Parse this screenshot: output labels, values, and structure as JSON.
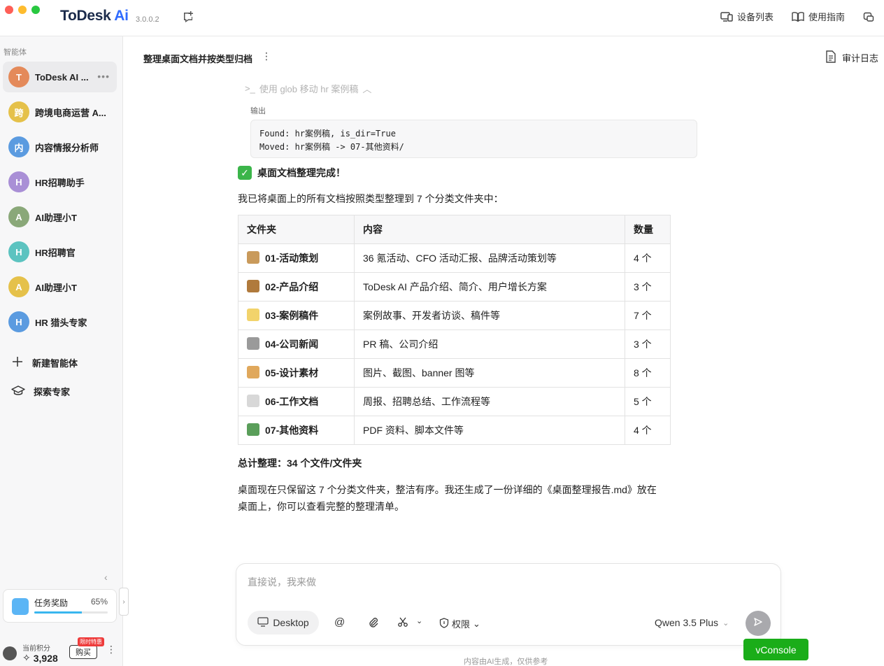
{
  "app": {
    "brand_main": "ToDesk ",
    "brand_ai": "Ai",
    "version": "3.0.0.2",
    "top_actions": {
      "devices": "设备列表",
      "guide": "使用指南"
    }
  },
  "sidebar": {
    "section_label": "智能体",
    "agents": [
      {
        "initial": "T",
        "name": "ToDesk AI ...",
        "color": "#e48a5a"
      },
      {
        "initial": "跨",
        "name": "跨境电商运营 A...",
        "color": "#e5c14a"
      },
      {
        "initial": "内",
        "name": "内容情报分析师",
        "color": "#5b9be0"
      },
      {
        "initial": "H",
        "name": "HR招聘助手",
        "color": "#a98fd6"
      },
      {
        "initial": "A",
        "name": "AI助理小T",
        "color": "#8aa879"
      },
      {
        "initial": "H",
        "name": "HR招聘官",
        "color": "#5cc3c0"
      },
      {
        "initial": "A",
        "name": "AI助理小T",
        "color": "#e5c14a"
      },
      {
        "initial": "H",
        "name": "HR 猎头专家",
        "color": "#5b9be0"
      }
    ],
    "new_agent": "新建智能体",
    "explore": "探索专家",
    "reward": {
      "title": "任务奖励",
      "percent": "65%",
      "progress": 0.65
    },
    "points_label": "当前积分",
    "points_value": "3,928",
    "promo_badge": "限时特惠",
    "buy_label": "购买"
  },
  "main": {
    "conversation_title": "整理桌面文档并按类型归档",
    "audit_log": "审计日志",
    "tool_call": "使用 glob 移动 hr 案例稿",
    "output_label": "输出",
    "code_lines": [
      "Found: hr案例稿, is_dir=True",
      "Moved: hr案例稿 -> 07-其他资料/"
    ],
    "done_title": "桌面文档整理完成！",
    "intro": "我已将桌面上的所有文档按照类型整理到 7 个分类文件夹中：",
    "table": {
      "headers": [
        "文件夹",
        "内容",
        "数量"
      ],
      "rows": [
        {
          "icon": "clipboard-icon",
          "icon_color": "#c99a5b",
          "folder": "01-活动策划",
          "content": "36 氪活动、CFO 活动汇报、品牌活动策划等",
          "count": "4 个"
        },
        {
          "icon": "package-icon",
          "icon_color": "#b07a3c",
          "folder": "02-产品介绍",
          "content": "ToDesk AI 产品介绍、简介、用户增长方案",
          "count": "3 个"
        },
        {
          "icon": "memo-icon",
          "icon_color": "#f2d36b",
          "folder": "03-案例稿件",
          "content": "案例故事、开发者访谈、稿件等",
          "count": "7 个"
        },
        {
          "icon": "newspaper-icon",
          "icon_color": "#9a9a9a",
          "folder": "04-公司新闻",
          "content": "PR 稿、公司介绍",
          "count": "3 个"
        },
        {
          "icon": "palette-icon",
          "icon_color": "#e0a85c",
          "folder": "05-设计素材",
          "content": "图片、截图、banner 图等",
          "count": "8 个"
        },
        {
          "icon": "document-icon",
          "icon_color": "#d8d8d8",
          "folder": "06-工作文档",
          "content": "周报、招聘总结、工作流程等",
          "count": "5 个"
        },
        {
          "icon": "books-icon",
          "icon_color": "#5a9e5a",
          "folder": "07-其他资料",
          "content": "PDF 资料、脚本文件等",
          "count": "4 个"
        }
      ]
    },
    "total": "总计整理：34 个文件/文件夹",
    "summary": "桌面现在只保留这 7 个分类文件夹，整洁有序。我还生成了一份详细的《桌面整理报告.md》放在桌面上，你可以查看完整的整理清单。"
  },
  "composer": {
    "placeholder": "直接说，我来做",
    "desktop_chip": "Desktop",
    "permission": "权限",
    "model": "Qwen 3.5 Plus"
  },
  "vconsole": "vConsole",
  "disclaimer": "内容由AI生成，仅供参考"
}
